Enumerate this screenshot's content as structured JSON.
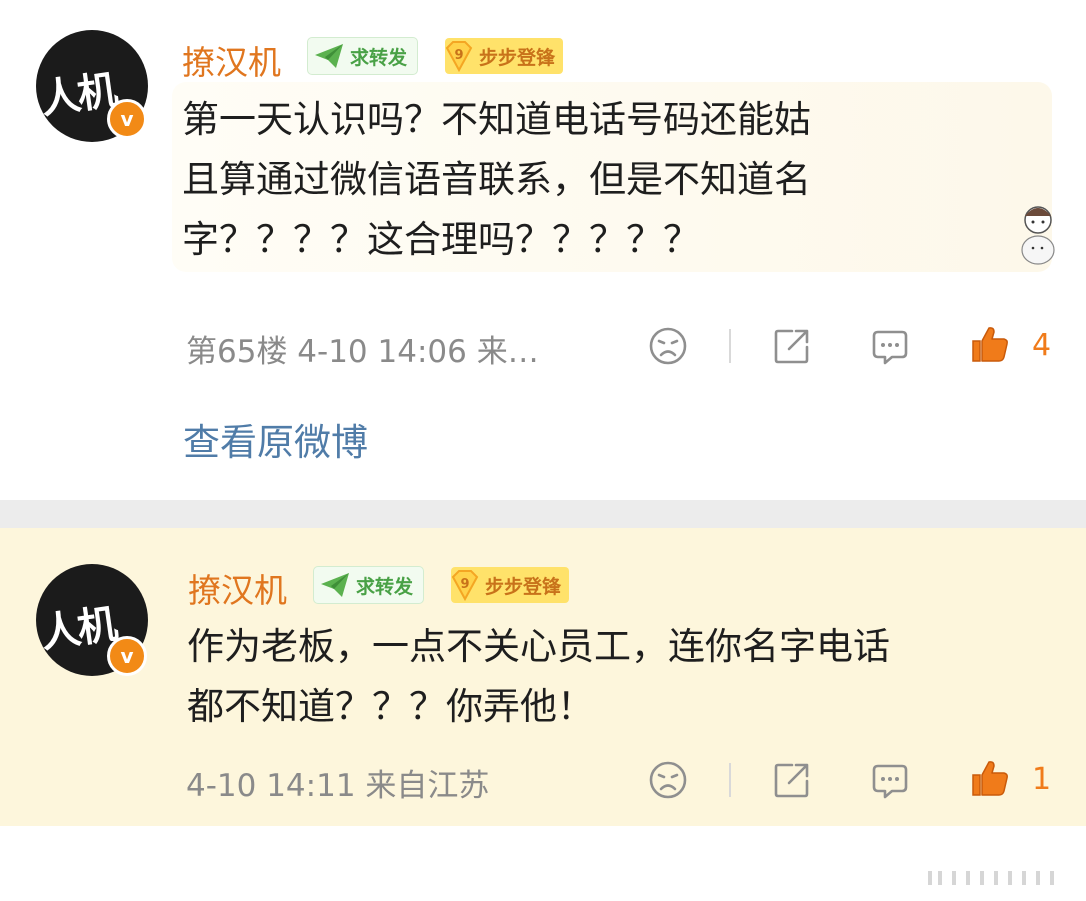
{
  "comments": [
    {
      "avatar_text": "人机",
      "verified": "v",
      "username": "撩汉机",
      "tag_forward": "求转发",
      "tag_level": "9",
      "tag_step": "步步登锋",
      "line1": "第一天认识吗？不知道电话号码还能姑",
      "line2": "且算通过微信语音联系，但是不知道名",
      "line3": "字？？？？这合理吗？？？？？",
      "meta": "第65楼 4-10 14:06 来…",
      "like_count": "4"
    },
    {
      "avatar_text": "人机",
      "verified": "v",
      "username": "撩汉机",
      "tag_forward": "求转发",
      "tag_level": "9",
      "tag_step": "步步登锋",
      "line1": "作为老板，一点不关心员工，连你名字电话",
      "line2": "都不知道？？？你弄他！",
      "meta": "4-10 14:11 来自江苏",
      "like_count": "1"
    }
  ],
  "view_original": "查看原微博",
  "icons": {
    "dislike": "sad-face-icon",
    "share": "share-icon",
    "comment": "comment-icon",
    "like": "thumbs-up-icon"
  },
  "colors": {
    "username": "#e0761f",
    "highlight_bg": "#fdf6dc",
    "link": "#507ca8",
    "like": "#f07b1a"
  }
}
